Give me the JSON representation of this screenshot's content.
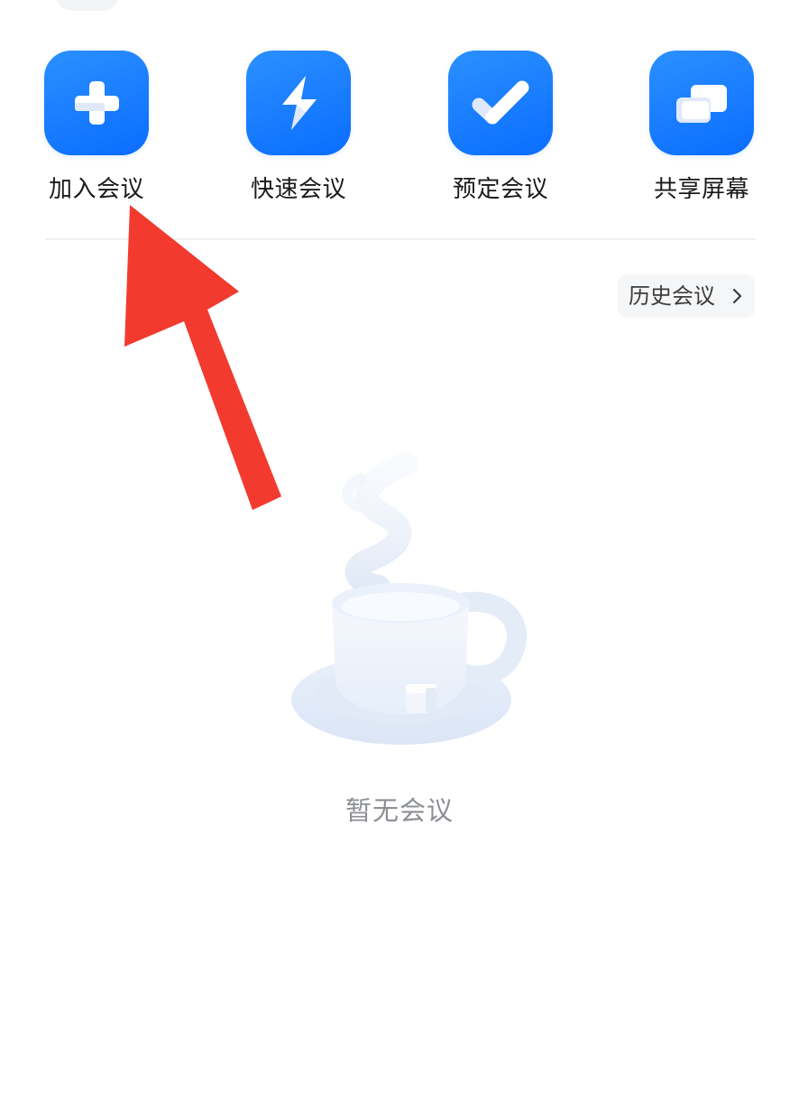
{
  "actions": [
    {
      "label": "加入会议",
      "icon": "plus-icon"
    },
    {
      "label": "快速会议",
      "icon": "lightning-icon"
    },
    {
      "label": "预定会议",
      "icon": "checkmark-icon"
    },
    {
      "label": "共享屏幕",
      "icon": "share-screen-icon"
    }
  ],
  "history": {
    "label": "历史会议",
    "icon": "chevron-right-icon"
  },
  "empty_state": {
    "text": "暂无会议",
    "illustration": "coffee-cup-illustration"
  },
  "annotation": {
    "icon": "red-arrow-pointer",
    "color": "#f23a2e"
  },
  "colors": {
    "accent": "#1477ff",
    "divider": "#eef0f3",
    "muted_text": "#8c8f94"
  }
}
